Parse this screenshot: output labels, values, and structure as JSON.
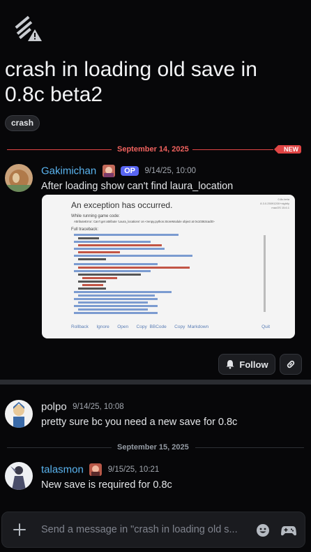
{
  "thread": {
    "title": "crash in loading old save in 0.8c beta2",
    "tag": "crash"
  },
  "dividers": {
    "first_date": "September 14, 2025",
    "new_badge": "NEW",
    "second_date": "September 15, 2025"
  },
  "messages": [
    {
      "user": "Gakimichan",
      "badge": "OP",
      "timestamp": "9/14/25, 10:00",
      "text": "After loading show can't find laura_location"
    },
    {
      "user": "polpo",
      "timestamp": "9/14/25, 10:08",
      "text": "pretty sure bc you need a new save for 0.8c"
    },
    {
      "user": "talasmon",
      "timestamp": "9/15/25, 10:21",
      "text": "New save is required for 0.8c"
    }
  ],
  "attachment": {
    "heading": "An exception has occurred.",
    "version_lines": [
      "0.8c.beta",
      "8.3.0.25091200+nightly",
      "macOS 15.6.1"
    ],
    "running_label": "While running game code:",
    "error_line": "AttributeError: Can't get attribute 'Laura_locations' on <renpy.python.StoreModule object at 0x10363cad0>",
    "traceback_label": "Full traceback:",
    "actions": [
      "Rollback",
      "Ignore",
      "Open",
      "Copy BBCode",
      "Copy Markdown"
    ],
    "quit": "Quit"
  },
  "actions": {
    "follow": "Follow"
  },
  "composer": {
    "placeholder": "Send a message in \"crash in loading old s..."
  },
  "icons": {
    "thread": "thread-warning-icon",
    "follow": "bell-icon",
    "link": "link-icon",
    "plus": "plus-icon",
    "emoji": "emoji-icon",
    "gift": "gamepad-icon"
  },
  "colors": {
    "background": "#070709",
    "username": "#5ab4f0",
    "new_divider": "#e04545",
    "op_badge": "#5865f2"
  }
}
